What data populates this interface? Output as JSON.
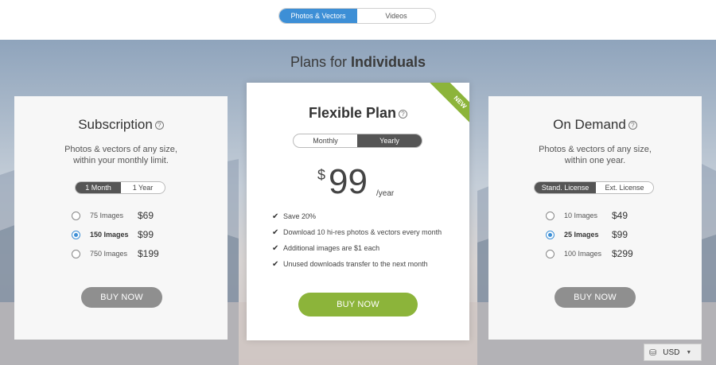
{
  "top_toggle": {
    "photos_vectors": "Photos & Vectors",
    "videos": "Videos"
  },
  "hero": {
    "title_prefix": "Plans for",
    "title_bold": "Individuals"
  },
  "subscription": {
    "title": "Subscription",
    "desc_line1": "Photos & vectors of any size,",
    "desc_line2": "within your monthly limit.",
    "toggle": {
      "month": "1 Month",
      "year": "1 Year"
    },
    "options": [
      {
        "label": "75 Images",
        "price": "$69",
        "selected": false
      },
      {
        "label": "150 Images",
        "price": "$99",
        "selected": true
      },
      {
        "label": "750 Images",
        "price": "$199",
        "selected": false
      }
    ],
    "buy": "BUY NOW"
  },
  "flexible": {
    "title": "Flexible Plan",
    "ribbon": "NEW",
    "toggle": {
      "monthly": "Monthly",
      "yearly": "Yearly"
    },
    "currency_symbol": "$",
    "amount": "99",
    "period": "/year",
    "features": [
      "Save 20%",
      "Download 10 hi-res photos & vectors every month",
      "Additional images are $1 each",
      "Unused downloads transfer to the next month"
    ],
    "buy": "BUY NOW"
  },
  "on_demand": {
    "title": "On Demand",
    "desc_line1": "Photos & vectors of any size,",
    "desc_line2": "within one year.",
    "toggle": {
      "standard": "Stand. License",
      "extended": "Ext. License"
    },
    "options": [
      {
        "label": "10 Images",
        "price": "$49",
        "selected": false
      },
      {
        "label": "25 Images",
        "price": "$99",
        "selected": true
      },
      {
        "label": "100 Images",
        "price": "$299",
        "selected": false
      }
    ],
    "buy": "BUY NOW"
  },
  "currency_selector": {
    "value": "USD"
  },
  "colors": {
    "accent_blue": "#3d8fd6",
    "accent_green": "#8cb43a",
    "button_gray": "#8f8f8f"
  }
}
